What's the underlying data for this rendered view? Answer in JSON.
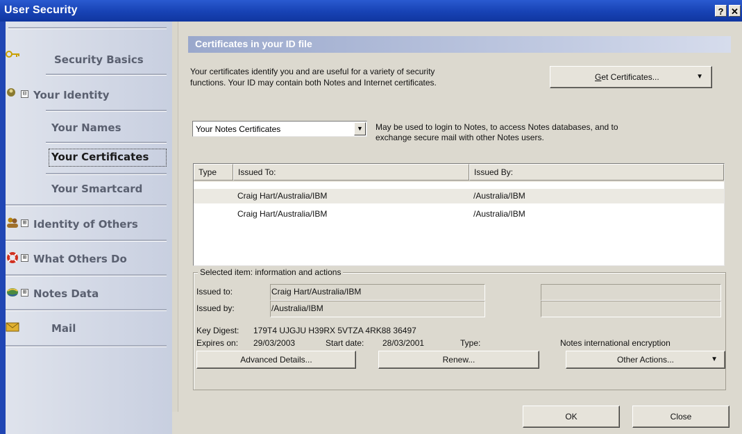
{
  "window": {
    "title": "User Security",
    "help_glyph": "?",
    "close_glyph": "✕"
  },
  "sidebar": {
    "items": [
      {
        "label": "Security Basics",
        "icon": "key-icon",
        "expander": ""
      },
      {
        "label": "Your Identity",
        "icon": "identity-icon",
        "expander": "⊟"
      },
      {
        "label": "Your Names",
        "icon": "",
        "expander": ""
      },
      {
        "label": "Your Certificates",
        "icon": "",
        "expander": "",
        "active": true
      },
      {
        "label": "Your Smartcard",
        "icon": "",
        "expander": ""
      },
      {
        "label": "Identity of Others",
        "icon": "people-icon",
        "expander": "⊞"
      },
      {
        "label": "What Others Do",
        "icon": "lifebuoy-icon",
        "expander": "⊞"
      },
      {
        "label": "Notes Data",
        "icon": "database-icon",
        "expander": "⊞"
      },
      {
        "label": "Mail",
        "icon": "mail-icon",
        "expander": ""
      }
    ]
  },
  "main": {
    "section_title": "Certificates in your ID file",
    "intro_line1": "Your certificates identify you and are useful for a variety of security",
    "intro_line2": "functions.  Your ID may contain both Notes and Internet certificates.",
    "get_certificates_button": "Get Certificates...",
    "get_certificates_access_key": "G",
    "certificate_type_selected": "Your Notes Certificates",
    "certificate_type_desc1": "May be used to login to Notes, to access Notes databases, and to",
    "certificate_type_desc2": "exchange secure mail with other Notes users.",
    "table": {
      "columns": [
        "Type",
        "Issued To:",
        "Issued By:"
      ],
      "rows": [
        {
          "type": "",
          "issued_to": "Craig Hart/Australia/IBM",
          "issued_by": "/Australia/IBM"
        },
        {
          "type": "",
          "issued_to": "Craig Hart/Australia/IBM",
          "issued_by": "/Australia/IBM"
        }
      ]
    },
    "details": {
      "group_title": "Selected item: information and actions",
      "issued_to_label": "Issued to:",
      "issued_to_value": "Craig Hart/Australia/IBM",
      "issued_by_label": "Issued by:",
      "issued_by_value": "/Australia/IBM",
      "key_digest_label": "Key Digest:",
      "key_digest_value": "179T4 UJGJU H39RX 5VTZA 4RK88 36497",
      "expires_label": "Expires on:",
      "expires_value": "29/03/2003",
      "start_label": "Start date:",
      "start_value": "28/03/2001",
      "type_label": "Type:",
      "type_value": "Notes international encryption"
    },
    "buttons": {
      "advanced_details": "Advanced Details...",
      "renew": "Renew...",
      "other_actions": "Other Actions...",
      "ok": "OK",
      "close": "Close"
    }
  }
}
